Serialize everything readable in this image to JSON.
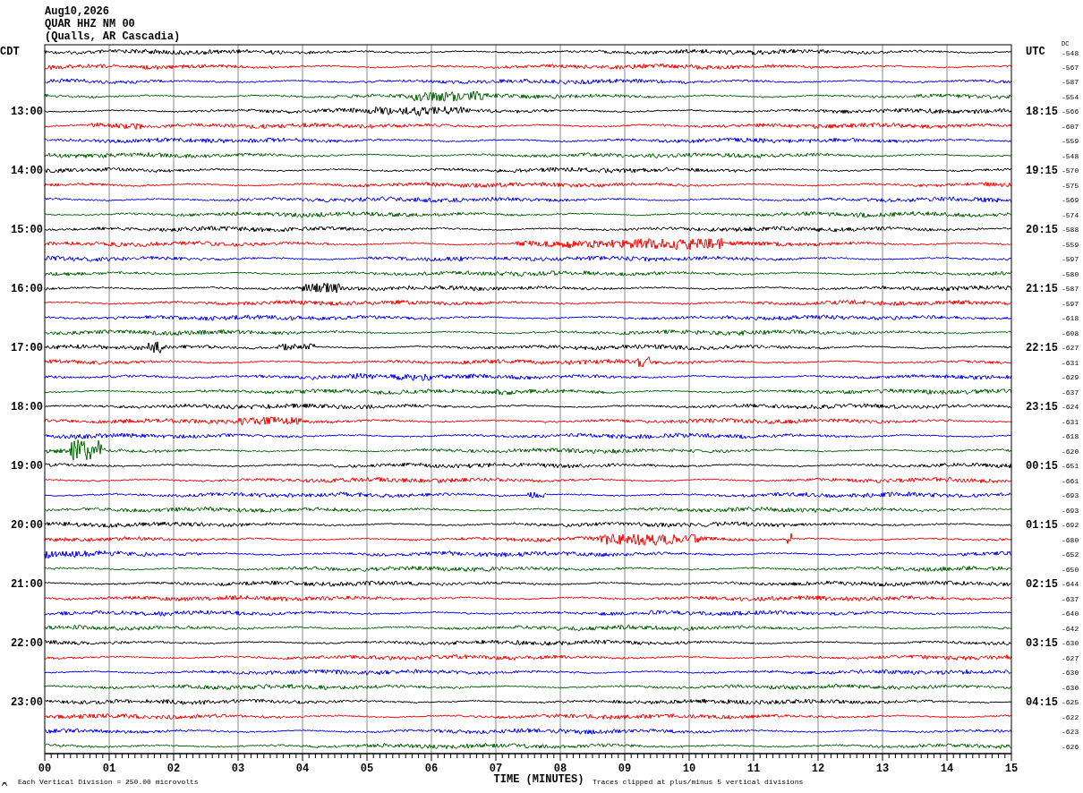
{
  "header": [
    "Aug10,2026",
    "QUAR HHZ NM 00",
    "(Qualls, AR Cascadia)"
  ],
  "left_zone": "CDT",
  "right_zone": "UTC",
  "dc_label": "DC",
  "traces": [
    {
      "color": "#000000",
      "dc": "-548"
    },
    {
      "color": "#ff0000",
      "dc": "-567"
    },
    {
      "color": "#0000ff",
      "dc": "-587"
    },
    {
      "color": "#006400",
      "dc": "-554"
    },
    {
      "color": "#000000",
      "dc": "-566"
    },
    {
      "color": "#ff0000",
      "dc": "-607"
    },
    {
      "color": "#0000ff",
      "dc": "-559"
    },
    {
      "color": "#006400",
      "dc": "-548"
    },
    {
      "color": "#000000",
      "dc": "-570"
    },
    {
      "color": "#ff0000",
      "dc": "-575"
    },
    {
      "color": "#0000ff",
      "dc": "-569"
    },
    {
      "color": "#006400",
      "dc": "-574"
    },
    {
      "color": "#000000",
      "dc": "-588"
    },
    {
      "color": "#ff0000",
      "dc": "-559"
    },
    {
      "color": "#0000ff",
      "dc": "-597"
    },
    {
      "color": "#006400",
      "dc": "-580"
    },
    {
      "color": "#000000",
      "dc": "-587"
    },
    {
      "color": "#ff0000",
      "dc": "-597"
    },
    {
      "color": "#0000ff",
      "dc": "-618"
    },
    {
      "color": "#006400",
      "dc": "-608"
    },
    {
      "color": "#000000",
      "dc": "-627"
    },
    {
      "color": "#ff0000",
      "dc": "-631"
    },
    {
      "color": "#0000ff",
      "dc": "-629"
    },
    {
      "color": "#006400",
      "dc": "-637"
    },
    {
      "color": "#000000",
      "dc": "-624"
    },
    {
      "color": "#ff0000",
      "dc": "-631"
    },
    {
      "color": "#0000ff",
      "dc": "-618"
    },
    {
      "color": "#006400",
      "dc": "-620"
    },
    {
      "color": "#000000",
      "dc": "-651"
    },
    {
      "color": "#ff0000",
      "dc": "-661"
    },
    {
      "color": "#0000ff",
      "dc": "-693"
    },
    {
      "color": "#006400",
      "dc": "-693"
    },
    {
      "color": "#000000",
      "dc": "-692"
    },
    {
      "color": "#ff0000",
      "dc": "-680"
    },
    {
      "color": "#0000ff",
      "dc": "-652"
    },
    {
      "color": "#006400",
      "dc": "-650"
    },
    {
      "color": "#000000",
      "dc": "-644"
    },
    {
      "color": "#ff0000",
      "dc": "-637"
    },
    {
      "color": "#0000ff",
      "dc": "-640"
    },
    {
      "color": "#006400",
      "dc": "-642"
    },
    {
      "color": "#000000",
      "dc": "-630"
    },
    {
      "color": "#ff0000",
      "dc": "-627"
    },
    {
      "color": "#0000ff",
      "dc": "-630"
    },
    {
      "color": "#006400",
      "dc": "-630"
    },
    {
      "color": "#000000",
      "dc": "-625"
    },
    {
      "color": "#ff0000",
      "dc": "-622"
    },
    {
      "color": "#0000ff",
      "dc": "-623"
    },
    {
      "color": "#006400",
      "dc": "-626"
    }
  ],
  "hours": [
    {
      "cdt": "13:00",
      "utc": "18:15"
    },
    {
      "cdt": "14:00",
      "utc": "19:15"
    },
    {
      "cdt": "15:00",
      "utc": "20:15"
    },
    {
      "cdt": "16:00",
      "utc": "21:15"
    },
    {
      "cdt": "17:00",
      "utc": "22:15"
    },
    {
      "cdt": "18:00",
      "utc": "23:15"
    },
    {
      "cdt": "19:00",
      "utc": "00:15"
    },
    {
      "cdt": "20:00",
      "utc": "01:15"
    },
    {
      "cdt": "21:00",
      "utc": "02:15"
    },
    {
      "cdt": "22:00",
      "utc": "03:15"
    },
    {
      "cdt": "23:00",
      "utc": "04:15"
    }
  ],
  "x_ticks": [
    "00",
    "01",
    "02",
    "03",
    "04",
    "05",
    "06",
    "07",
    "08",
    "09",
    "10",
    "11",
    "12",
    "13",
    "14",
    "15"
  ],
  "x_label": "TIME (MINUTES)",
  "scale_note": "Each Vertical Division =  250.00 microvolts",
  "clip_note": "Traces clipped at plus/minus 5 vertical divisions"
}
